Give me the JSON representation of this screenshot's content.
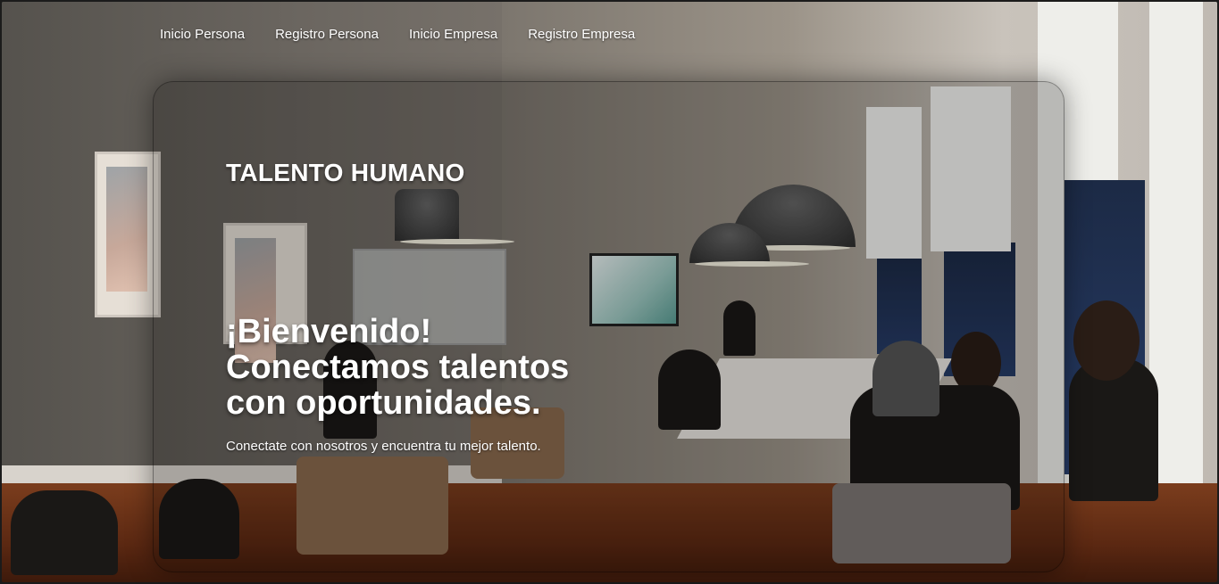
{
  "nav": {
    "items": [
      {
        "label": "Inicio Persona"
      },
      {
        "label": "Registro Persona"
      },
      {
        "label": "Inicio Empresa"
      },
      {
        "label": "Registro Empresa"
      }
    ]
  },
  "hero": {
    "brand": "TALENTO HUMANO",
    "headline_lines": [
      "¡Bienvenido!",
      "Conectamos talentos",
      "con oportunidades."
    ],
    "tagline": "Conectate con nosotros y encuentra tu mejor talento."
  },
  "background": {
    "image": "office-meeting-room-photo",
    "overlay_color": "#000000"
  }
}
